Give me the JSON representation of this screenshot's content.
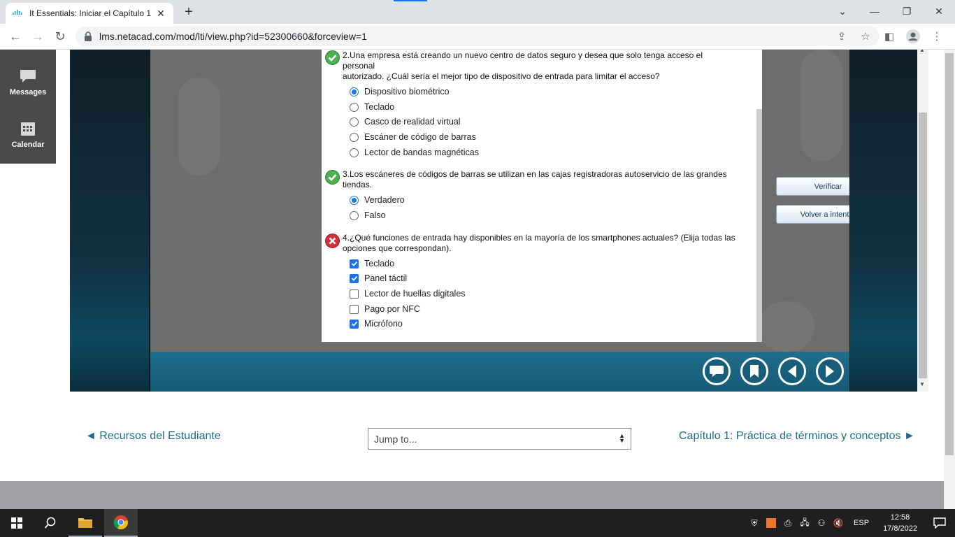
{
  "browser": {
    "tab_title": "It Essentials: Iniciar el Capítulo 1",
    "url": "lms.netacad.com/mod/lti/view.php?id=52300660&forceview=1"
  },
  "sidebar": {
    "items": [
      {
        "label": "Messages",
        "icon": "chat-bubble-icon"
      },
      {
        "label": "Calendar",
        "icon": "calendar-icon"
      }
    ]
  },
  "quiz": {
    "questions": [
      {
        "status": "correct",
        "text_line1": "2.Una empresa está creando un nuevo centro de datos seguro y desea que solo tenga acceso el",
        "text_line2": "personal",
        "text_line3": "autorizado. ¿Cuál sería el mejor tipo de dispositivo de entrada para limitar el acceso?",
        "type": "radio",
        "options": [
          {
            "label": "Dispositivo biométrico",
            "selected": true
          },
          {
            "label": "Teclado",
            "selected": false
          },
          {
            "label": "Casco de realidad virtual",
            "selected": false
          },
          {
            "label": "Escáner de código de barras",
            "selected": false
          },
          {
            "label": "Lector de bandas magnéticas",
            "selected": false
          }
        ]
      },
      {
        "status": "correct",
        "text_line1": "3.Los escáneres de códigos de barras se utilizan en las cajas registradoras autoservicio de las grandes",
        "text_line2": "tiendas.",
        "type": "radio",
        "options": [
          {
            "label": "Verdadero",
            "selected": true
          },
          {
            "label": "Falso",
            "selected": false
          }
        ]
      },
      {
        "status": "incorrect",
        "text_line1": "4.¿Qué funciones de entrada hay disponibles en la mayoría de los smartphones actuales? (Elija todas las",
        "text_line2": "opciones que correspondan).",
        "type": "checkbox",
        "options": [
          {
            "label": "Teclado",
            "selected": true
          },
          {
            "label": "Panel táctil",
            "selected": true
          },
          {
            "label": "Lector de huellas digitales",
            "selected": false
          },
          {
            "label": "Pago por NFC",
            "selected": false
          },
          {
            "label": "Micrófono",
            "selected": true
          }
        ]
      }
    ],
    "verify_label": "Verificar",
    "retry_label": "Volver a intentar"
  },
  "footer_nav": {
    "prev_label": "◄ Recursos del Estudiante",
    "jump_placeholder": "Jump to...",
    "next_label": "Capítulo 1: Práctica de términos y conceptos ►"
  },
  "taskbar": {
    "language": "ESP",
    "time": "12:58",
    "date": "17/8/2022"
  }
}
